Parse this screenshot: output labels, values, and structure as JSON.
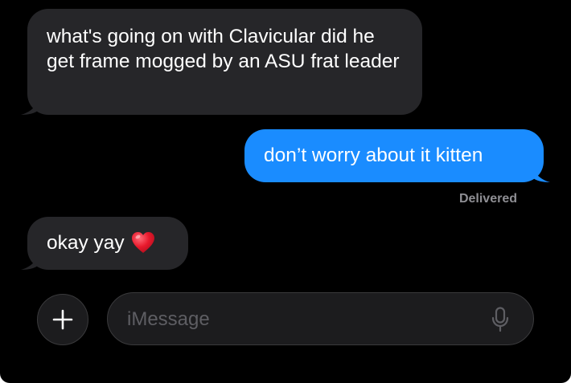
{
  "conversation": {
    "messages": [
      {
        "direction": "incoming",
        "text": "what's going on with Clavicular did he get frame mogged by an ASU frat leader"
      },
      {
        "direction": "outgoing",
        "text": "don’t worry about it kitten"
      },
      {
        "direction": "incoming",
        "text": "okay yay",
        "emoji": "heart-emoji"
      }
    ],
    "delivery_status": "Delivered"
  },
  "compose": {
    "placeholder": "iMessage",
    "add_icon": "plus-icon",
    "mic_icon": "microphone-icon"
  },
  "colors": {
    "background": "#000000",
    "incoming_bubble": "#262629",
    "outgoing_bubble": "#1a8cff",
    "status_text": "#8e8e93",
    "heart": "#e8192c"
  }
}
